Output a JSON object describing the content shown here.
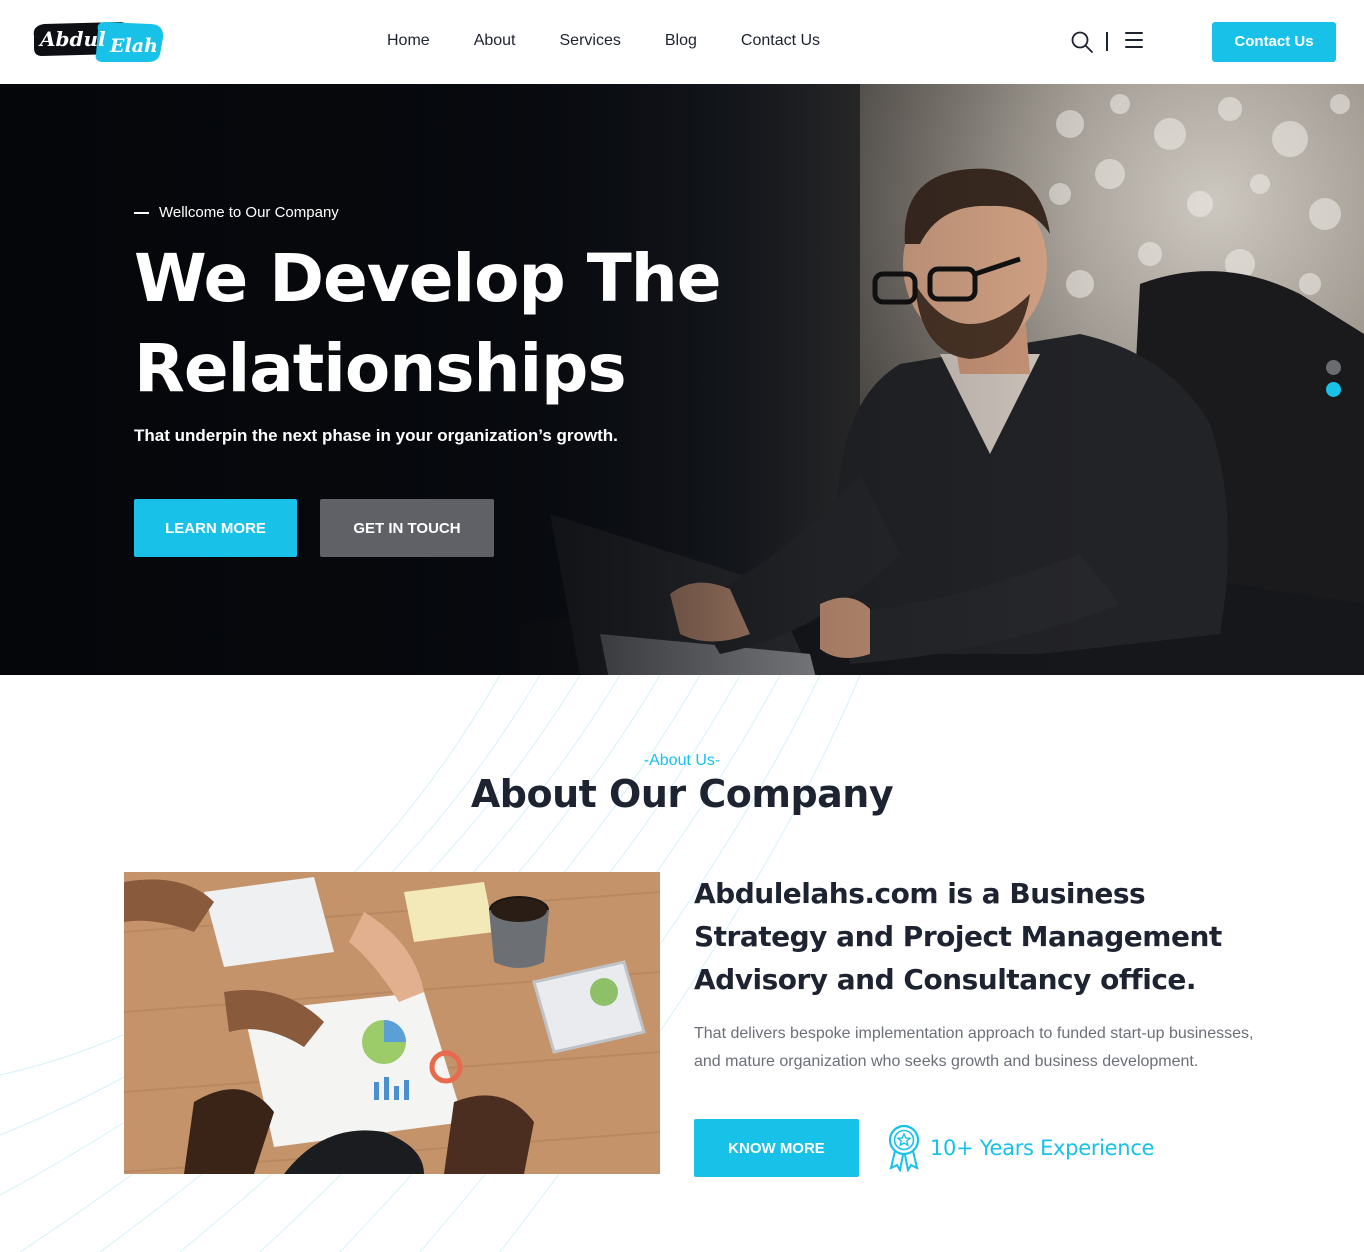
{
  "header": {
    "logo": {
      "line1": "Abdul",
      "line2": "Elah"
    },
    "nav": [
      "Home",
      "About",
      "Services",
      "Blog",
      "Contact Us"
    ],
    "cta_label": "Contact Us"
  },
  "hero": {
    "eyebrow": "Wellcome to Our Company",
    "title_line1": "We Develop The",
    "title_line2": "Relationships",
    "subtitle": "That underpin the next phase in your organization’s growth.",
    "primary_button": "LEARN MORE",
    "secondary_button": "GET IN TOUCH",
    "slides": {
      "count": 2,
      "active_index": 1
    }
  },
  "about": {
    "eyebrow": "-About Us-",
    "title": "About Our Company",
    "heading": "Abdulelahs.com is a Business Strategy and Project Management Advisory and Consultancy office.",
    "description": "That delivers bespoke implementation approach to funded start-up businesses, and mature organization who seeks growth and business development.",
    "button": "KNOW MORE",
    "experience": "10+ Years Experience"
  },
  "colors": {
    "accent": "#17c1e8",
    "dark_text": "#1d2330",
    "muted_text": "#6b6f78",
    "secondary_button": "#5f6166"
  },
  "icons": {
    "search": "search-icon",
    "menu": "hamburger-menu-icon",
    "experience": "award-ribbon-icon"
  }
}
